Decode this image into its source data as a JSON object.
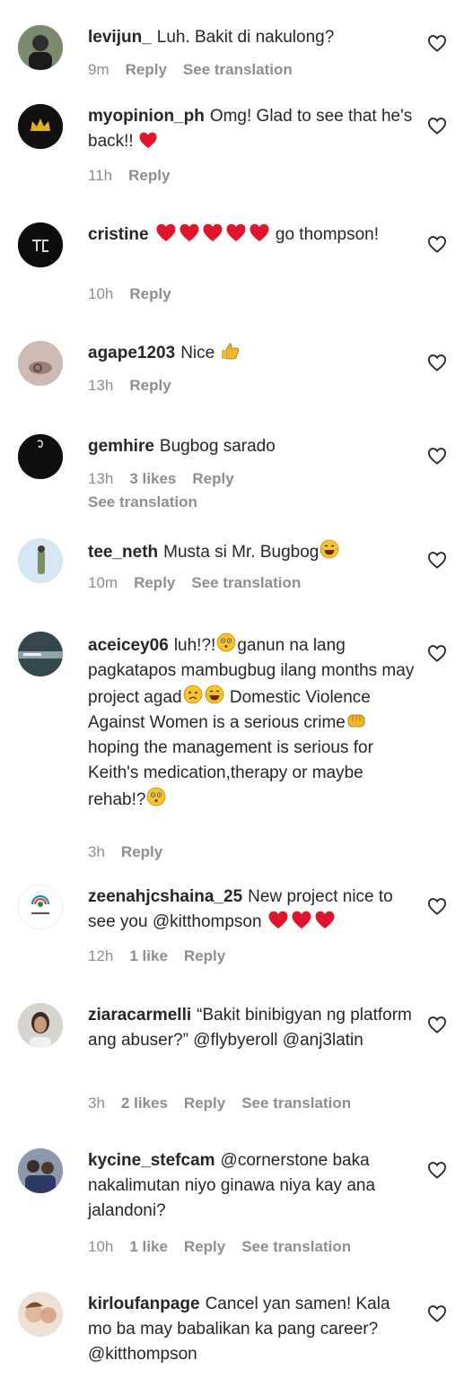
{
  "comments": [
    {
      "username": "levijun_",
      "text": "Luh. Bakit di nakulong?",
      "time": "9m",
      "likes": "",
      "reply": "Reply",
      "translate": "See translation"
    },
    {
      "username": "myopinion_ph",
      "text": "Omg! Glad to see that he's back!!",
      "time": "11h",
      "likes": "",
      "reply": "Reply",
      "translate": ""
    },
    {
      "username": "cristine",
      "text": "go thompson!",
      "time": "10h",
      "likes": "",
      "reply": "Reply",
      "translate": ""
    },
    {
      "username": "agape1203",
      "text": "Nice",
      "time": "13h",
      "likes": "",
      "reply": "Reply",
      "translate": ""
    },
    {
      "username": "gemhire",
      "text": "Bugbog sarado",
      "time": "13h",
      "likes": "3 likes",
      "reply": "Reply",
      "translate": "See translation"
    },
    {
      "username": "tee_neth",
      "text": "Musta si Mr. Bugbog",
      "time": "10m",
      "likes": "",
      "reply": "Reply",
      "translate": "See translation"
    },
    {
      "username": "aceicey06",
      "text_1": "luh!?!",
      "text_2": "ganun na lang pagkatapos mambugbug ilang months may project agad",
      "text_3": "Domestic Violence Against Women is a serious crime",
      "text_4": "hoping the management is serious for Keith's medication,therapy or maybe rehab!?",
      "time": "3h",
      "likes": "",
      "reply": "Reply",
      "translate": ""
    },
    {
      "username": "zeenahjcshaina_25",
      "text": "New project nice to see you @kitthompson",
      "time": "12h",
      "likes": "1 like",
      "reply": "Reply",
      "translate": ""
    },
    {
      "username": "ziaracarmelli",
      "text": "“Bakit binibigyan ng platform ang abuser?” @flybyeroll @anj3latin",
      "time": "3h",
      "likes": "2 likes",
      "reply": "Reply",
      "translate": "See translation"
    },
    {
      "username": "kycine_stefcam",
      "text": "@cornerstone baka nakalimutan niyo ginawa niya kay ana jalandoni?",
      "time": "10h",
      "likes": "1 like",
      "reply": "Reply",
      "translate": "See translation"
    },
    {
      "username": "kirloufanpage",
      "text": "Cancel yan samen! Kala mo ba may babalikan ka pang career? @kitthompson",
      "time": "",
      "likes": "",
      "reply": "",
      "translate": ""
    }
  ],
  "colors": {
    "text": "#262626",
    "meta": "#8e8e8e",
    "heart_emoji": "#e0142a"
  },
  "icons": {
    "like": "heart-outline-icon"
  }
}
